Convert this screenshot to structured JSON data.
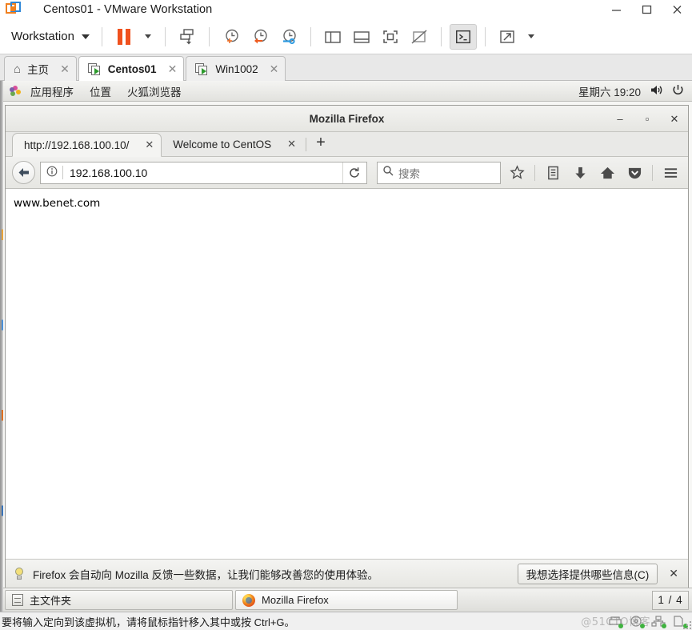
{
  "vmware": {
    "title": "Centos01 - VMware Workstation",
    "app_icon": "vmware-logo-icon",
    "window_controls": [
      {
        "name": "minimize-button",
        "glyph": "—"
      },
      {
        "name": "maximize-button",
        "glyph": "□"
      },
      {
        "name": "close-button",
        "glyph": "✕"
      }
    ],
    "toolbar": {
      "menu_label": "Workstation",
      "buttons": [
        {
          "name": "suspend-button",
          "icon": "pause-icon"
        },
        {
          "name": "power-dropdown-button",
          "icon": "chevron-down-icon"
        },
        {
          "name": "snapshot-button",
          "icon": "snapshot-icon"
        },
        {
          "name": "take-snapshot-button",
          "icon": "clock-plus-icon"
        },
        {
          "name": "revert-snapshot-button",
          "icon": "clock-back-icon"
        },
        {
          "name": "snapshot-manager-button",
          "icon": "clock-wrench-icon"
        },
        {
          "name": "show-library-button",
          "icon": "sidebar-panel-icon"
        },
        {
          "name": "show-thumbnail-bar-button",
          "icon": "bottom-panel-icon"
        },
        {
          "name": "show-console-view-button",
          "icon": "fullscreen-brackets-icon"
        },
        {
          "name": "hide-console-view-button",
          "icon": "crossed-panel-icon"
        },
        {
          "name": "unity-mode-button",
          "icon": "terminal-prompt-icon"
        },
        {
          "name": "enter-fullscreen-button",
          "icon": "expand-arrows-icon"
        },
        {
          "name": "fullscreen-dropdown-button",
          "icon": "chevron-down-icon"
        }
      ]
    },
    "tabs": [
      {
        "name": "tab-home",
        "label": "主页",
        "icon": "home-icon",
        "selected": false,
        "close": "✕"
      },
      {
        "name": "tab-centos01",
        "label": "Centos01",
        "icon": "vm-icon",
        "selected": true,
        "close": "✕"
      },
      {
        "name": "tab-win1002",
        "label": "Win1002",
        "icon": "vm-icon",
        "selected": false,
        "close": "✕"
      }
    ],
    "statusbar": {
      "message": "要将输入定向到该虚拟机，请将鼠标指针移入其中或按 Ctrl+G。",
      "watermark": "@51CTO博客",
      "devices": [
        {
          "name": "printer-device-icon"
        },
        {
          "name": "cdrom-device-icon"
        },
        {
          "name": "network-device-icon"
        },
        {
          "name": "usb-device-icon"
        }
      ]
    }
  },
  "guest": {
    "panel": {
      "apps_icon": "applications-icon",
      "items": [
        {
          "name": "menu-applications",
          "label": "应用程序"
        },
        {
          "name": "menu-places",
          "label": "位置"
        },
        {
          "name": "menu-firefox",
          "label": "火狐浏览器"
        }
      ],
      "clock": "星期六 19:20",
      "volume_icon": "volume-icon",
      "power_icon": "power-icon"
    },
    "taskbar": {
      "items": [
        {
          "name": "taskbar-item-home-folder",
          "label": "主文件夹",
          "icon": "file-manager-icon",
          "active": false
        },
        {
          "name": "taskbar-item-firefox",
          "label": "Mozilla Firefox",
          "icon": "firefox-icon",
          "active": true
        }
      ],
      "workspace": "1 / 4"
    }
  },
  "firefox": {
    "window_title": "Mozilla Firefox",
    "window_controls": [
      {
        "name": "minimize-button",
        "glyph": "‒"
      },
      {
        "name": "maximize-button",
        "glyph": "▫"
      },
      {
        "name": "close-button",
        "glyph": "✕"
      }
    ],
    "tabs": [
      {
        "name": "browser-tab-active",
        "label": "http://192.168.100.10/",
        "selected": true,
        "close": "✕"
      },
      {
        "name": "browser-tab-welcome",
        "label": "Welcome to CentOS",
        "selected": false,
        "close": "✕"
      }
    ],
    "new_tab_glyph": "+",
    "navbar": {
      "back_icon": "back-arrow-icon",
      "identity_icon": "info-circle-icon",
      "url_value": "192.168.100.10",
      "reload_icon": "reload-icon",
      "search_icon": "search-icon",
      "search_placeholder": "搜索",
      "icons": [
        {
          "name": "bookmark-star-icon"
        },
        {
          "name": "library-icon"
        },
        {
          "name": "downloads-icon"
        },
        {
          "name": "home-icon"
        },
        {
          "name": "pocket-icon"
        },
        {
          "name": "menu-hamburger-icon"
        }
      ]
    },
    "page": {
      "body_text": "www.benet.com"
    },
    "notification": {
      "icon": "lightbulb-icon",
      "message": "Firefox 会自动向 Mozilla 反馈一些数据，让我们能够改善您的使用体验。",
      "button_label": "我想选择提供哪些信息(C)",
      "close_glyph": "✕"
    }
  },
  "colors": {
    "vmware_orange": "#f0511e",
    "vm_play_green": "#2d9a2d",
    "blue_accent": "#2f87d8",
    "status_green": "#3fb23f"
  }
}
